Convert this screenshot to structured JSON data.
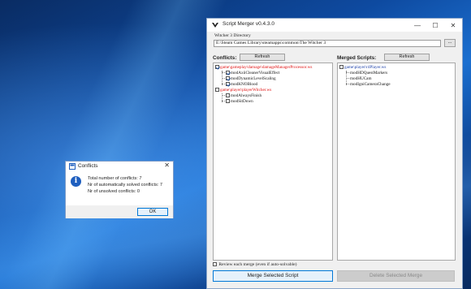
{
  "window": {
    "title": "Script Merger v0.4.3.0",
    "minimize_glyph": "—",
    "maximize_glyph": "☐",
    "close_glyph": "✕"
  },
  "directory": {
    "label": "Witcher 3 Directory",
    "value": "E:\\Steam Games Library\\steamapps\\common\\The Witcher 3",
    "browse_label": "..."
  },
  "conflicts": {
    "label": "Conflicts:",
    "refresh_label": "Refresh",
    "tree": [
      {
        "label": "game\\gameplay\\damage\\damageManagerProcessor.ws",
        "color": "#e01010",
        "checked": true,
        "children": [
          {
            "label": "modAxiiCleanerVisualEffect",
            "checked": true
          },
          {
            "label": "modDynamicLevelScaling",
            "checked": true
          },
          {
            "label": "modKNOBlood",
            "checked": true
          }
        ]
      },
      {
        "label": "game\\player\\playerWitcher.ws",
        "color": "#e01010",
        "checked": false,
        "children": [
          {
            "label": "modAlwaysFinish",
            "checked": false
          },
          {
            "label": "modSitDown",
            "checked": false
          }
        ]
      }
    ],
    "review_label": "Review each merge (even if auto-solvable)",
    "review_checked": false,
    "merge_button": "Merge Selected Script"
  },
  "merged": {
    "label": "Merged Scripts:",
    "refresh_label": "Refresh",
    "tree": [
      {
        "label": "game\\player\\r4Player.ws",
        "color": "#1a3ea8",
        "checked": false,
        "children": [
          {
            "label": "modHDQuestMarkers"
          },
          {
            "label": "modHUCam"
          },
          {
            "label": "modIgniCameraChange"
          }
        ]
      }
    ],
    "delete_button": "Delete Selected Merge"
  },
  "dialog": {
    "title": "Conflicts",
    "close_glyph": "✕",
    "icon_glyph": "i",
    "lines": [
      "Total number of conflicts: 7",
      "Nr of automatically solved conflicts: 7",
      "Nr of unsolved conflicts: 0"
    ],
    "ok_label": "OK"
  },
  "colors": {
    "conflict_file": "#e01010",
    "merged_file": "#1a3ea8",
    "accent_border": "#0078d7"
  }
}
